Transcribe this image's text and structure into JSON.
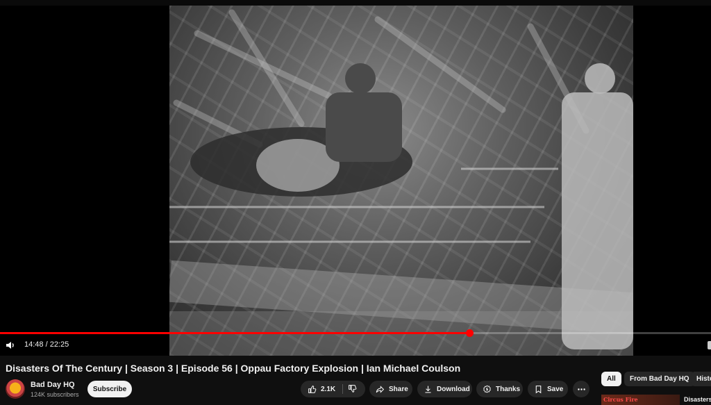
{
  "player": {
    "current_time": "14:48",
    "duration": "22:25",
    "time_display": "14:48 / 22:25",
    "progress": 0.6601
  },
  "video": {
    "title": "Disasters Of The Century | Season 3 | Episode 56 | Oppau Factory Explosion | Ian Michael Coulson"
  },
  "channel": {
    "name": "Bad Day HQ",
    "subscribers": "124K subscribers",
    "subscribe_label": "Subscribe"
  },
  "actions": {
    "like_count": "2.1K",
    "share_label": "Share",
    "download_label": "Download",
    "thanks_label": "Thanks",
    "save_label": "Save"
  },
  "chips": {
    "all": "All",
    "from_channel": "From Bad Day HQ",
    "history": "Histo"
  },
  "recommendation": {
    "thumb_text": "Circus Fire",
    "title": "Disasters"
  },
  "colors": {
    "accent": "#ff0000",
    "background": "#0f0f0f",
    "pill": "#272727"
  }
}
